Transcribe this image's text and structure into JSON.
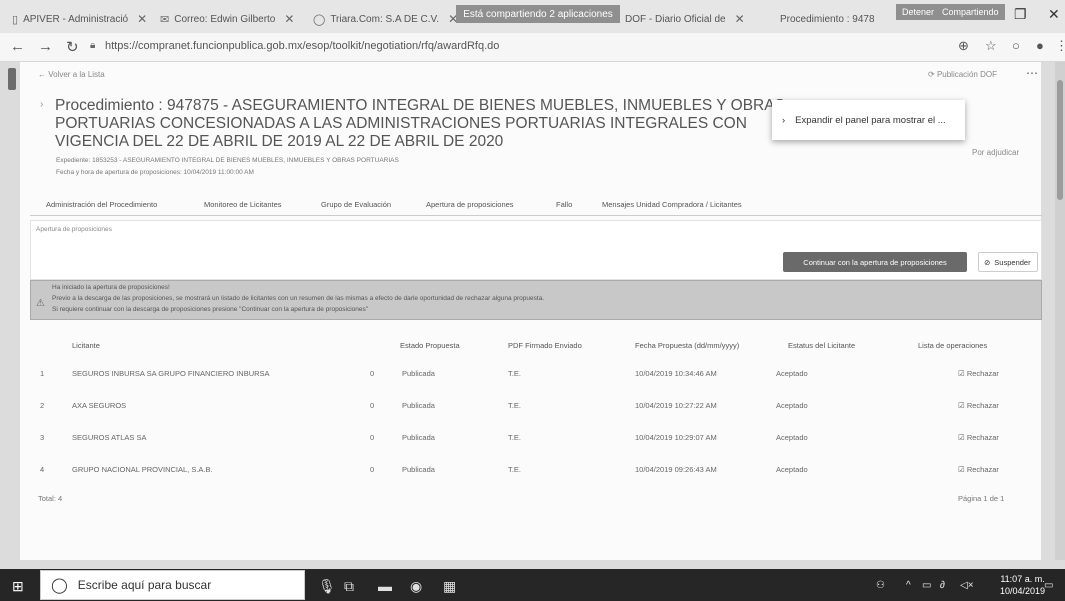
{
  "browser": {
    "tabs": [
      {
        "label": "APIVER - Administració"
      },
      {
        "label": "Correo: Edwin Gilberto"
      },
      {
        "label": "Triara.Com: S.A DE C.V."
      },
      {
        "label": "DOF - Diario Oficial de"
      },
      {
        "label": "Procedimiento : 9478"
      }
    ],
    "share_banner": "Está compartiendo 2 aplicaciones",
    "share_stop": "Detener",
    "share_share": "Compartiendo",
    "url": "https://compranet.funcionpublica.gob.mx/esop/toolkit/negotiation/rfq/awardRfq.do"
  },
  "page": {
    "back_link": "Volver a la Lista",
    "dof_link": "Publicación DOF",
    "title": "Procedimiento : 947875 - ASEGURAMIENTO INTEGRAL DE BIENES MUEBLES, INMUEBLES Y OBRAS PORTUARIAS CONCESIONADAS A LAS ADMINISTRACIONES PORTUARIAS INTEGRALES CON VIGENCIA DEL 22 DE ABRIL DE 2019 AL 22 DE ABRIL DE 2020",
    "expediente": "Expediente: 1853253 - ASEGURAMIENTO INTEGRAL DE BIENES MUEBLES, INMUEBLES Y OBRAS PORTUARIAS",
    "fecha_apertura": "Fecha y hora de apertura de proposiciones: 10/04/2019 11:00:00 AM",
    "right_note": "Por adjudicar",
    "popup_text": "Expandir el panel para mostrar el ...",
    "nav": [
      {
        "label": "Administración del Procedimiento"
      },
      {
        "label": "Monitoreo de Licitantes"
      },
      {
        "label": "Grupo de Evaluación"
      },
      {
        "label": "Apertura de proposiciones"
      },
      {
        "label": "Fallo"
      },
      {
        "label": "Mensajes Unidad Compradora / Licitantes"
      }
    ],
    "section_label": "Apertura de proposiciones",
    "btn_continuar": "Continuar con la apertura de proposiciones",
    "btn_suspender": "Suspender",
    "warning": [
      "Ha iniciado la apertura de proposiciones!",
      "Previo a la descarga de las proposiciones, se mostrará un listado de licitantes con un resumen de las mismas a efecto de darle oportunidad de rechazar alguna propuesta.",
      "Si requiere continuar con la descarga de proposiciones presione \"Continuar con la apertura de proposiciones\""
    ],
    "table": {
      "headers": [
        "Licitante",
        "Estado Propuesta",
        "PDF Firmado Enviado",
        "Fecha Propuesta (dd/mm/yyyy)",
        "Estatus del Licitante",
        "Lista de operaciones"
      ],
      "rows": [
        {
          "num": "1",
          "licitante": "SEGUROS INBURSA SA GRUPO FINANCIERO INBURSA",
          "count": "0",
          "estado": "Publicada",
          "pdf": "T.E.",
          "fecha": "10/04/2019 10:34:46 AM",
          "estatus": "Aceptado",
          "op": "Rechazar"
        },
        {
          "num": "2",
          "licitante": "AXA SEGUROS",
          "count": "0",
          "estado": "Publicada",
          "pdf": "T.E.",
          "fecha": "10/04/2019 10:27:22 AM",
          "estatus": "Aceptado",
          "op": "Rechazar"
        },
        {
          "num": "3",
          "licitante": "SEGUROS ATLAS SA",
          "count": "0",
          "estado": "Publicada",
          "pdf": "T.E.",
          "fecha": "10/04/2019 10:29:07 AM",
          "estatus": "Aceptado",
          "op": "Rechazar"
        },
        {
          "num": "4",
          "licitante": "GRUPO NACIONAL PROVINCIAL, S.A.B.",
          "count": "0",
          "estado": "Publicada",
          "pdf": "T.E.",
          "fecha": "10/04/2019 09:26:43 AM",
          "estatus": "Aceptado",
          "op": "Rechazar"
        }
      ],
      "total": "Total: 4",
      "pager": "Página 1 de 1"
    }
  },
  "taskbar": {
    "search_placeholder": "Escribe aquí para buscar",
    "time": "11:07 a. m.",
    "date": "10/04/2019"
  }
}
